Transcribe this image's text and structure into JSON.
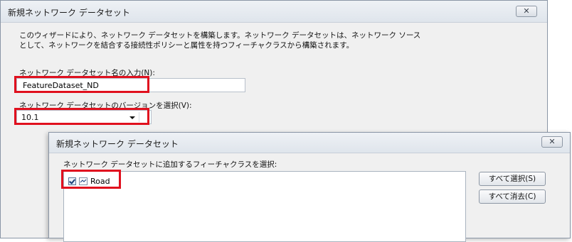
{
  "main_dialog": {
    "title": "新規ネットワーク データセット",
    "close_label": "✕",
    "description_line1": "このウィザードにより、ネットワーク データセットを構築します。ネットワーク データセットは、ネットワーク ソース",
    "description_line2": "として、ネットワークを結合する接続性ポリシーと属性を持つフィーチャクラスから構築されます。",
    "name_label": "ネットワーク データセット名の入力(N):",
    "name_value": "FeatureDataset_ND",
    "version_label": "ネットワーク データセットのバージョンを選択(V):",
    "version_value": "10.1"
  },
  "sub_dialog": {
    "title": "新規ネットワーク データセット",
    "close_label": "✕",
    "select_label": "ネットワーク データセットに追加するフィーチャクラスを選択:",
    "items": [
      {
        "label": "Road",
        "checked": true,
        "icon": "line-feature-icon"
      }
    ],
    "select_all_label": "すべて選択(S)",
    "clear_all_label": "すべて消去(C)"
  },
  "colors": {
    "highlight": "#e0101e",
    "dialog_bg": "#f0f0f0"
  }
}
